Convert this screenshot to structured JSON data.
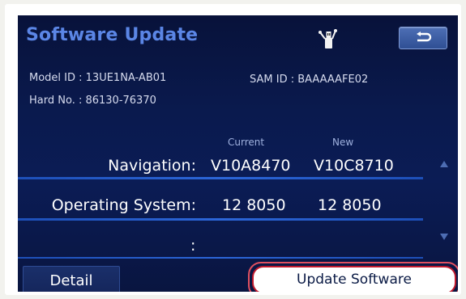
{
  "header": {
    "title": "Software Update",
    "usb_icon": "usb-icon",
    "back_icon": "return-arrow-icon"
  },
  "info": {
    "model_id": "Model ID : 13UE1NA-AB01",
    "part_no": "Hard No. : 86130-76370",
    "sam_id": "SAM ID : BAAAAAFE02"
  },
  "columns": {
    "current": "Current",
    "new": "New"
  },
  "rows": [
    {
      "label": "Navigation:",
      "current": "V10A8470",
      "new": "V10C8710"
    },
    {
      "label": "Operating System:",
      "current": "12 8050",
      "new": "12 8050"
    },
    {
      "label": ":",
      "current": "",
      "new": ""
    }
  ],
  "buttons": {
    "detail": "Detail",
    "update": "Update Software"
  },
  "colors": {
    "title": "#5b86e6",
    "highlight": "#e05060",
    "separator": "#2c66d8"
  }
}
